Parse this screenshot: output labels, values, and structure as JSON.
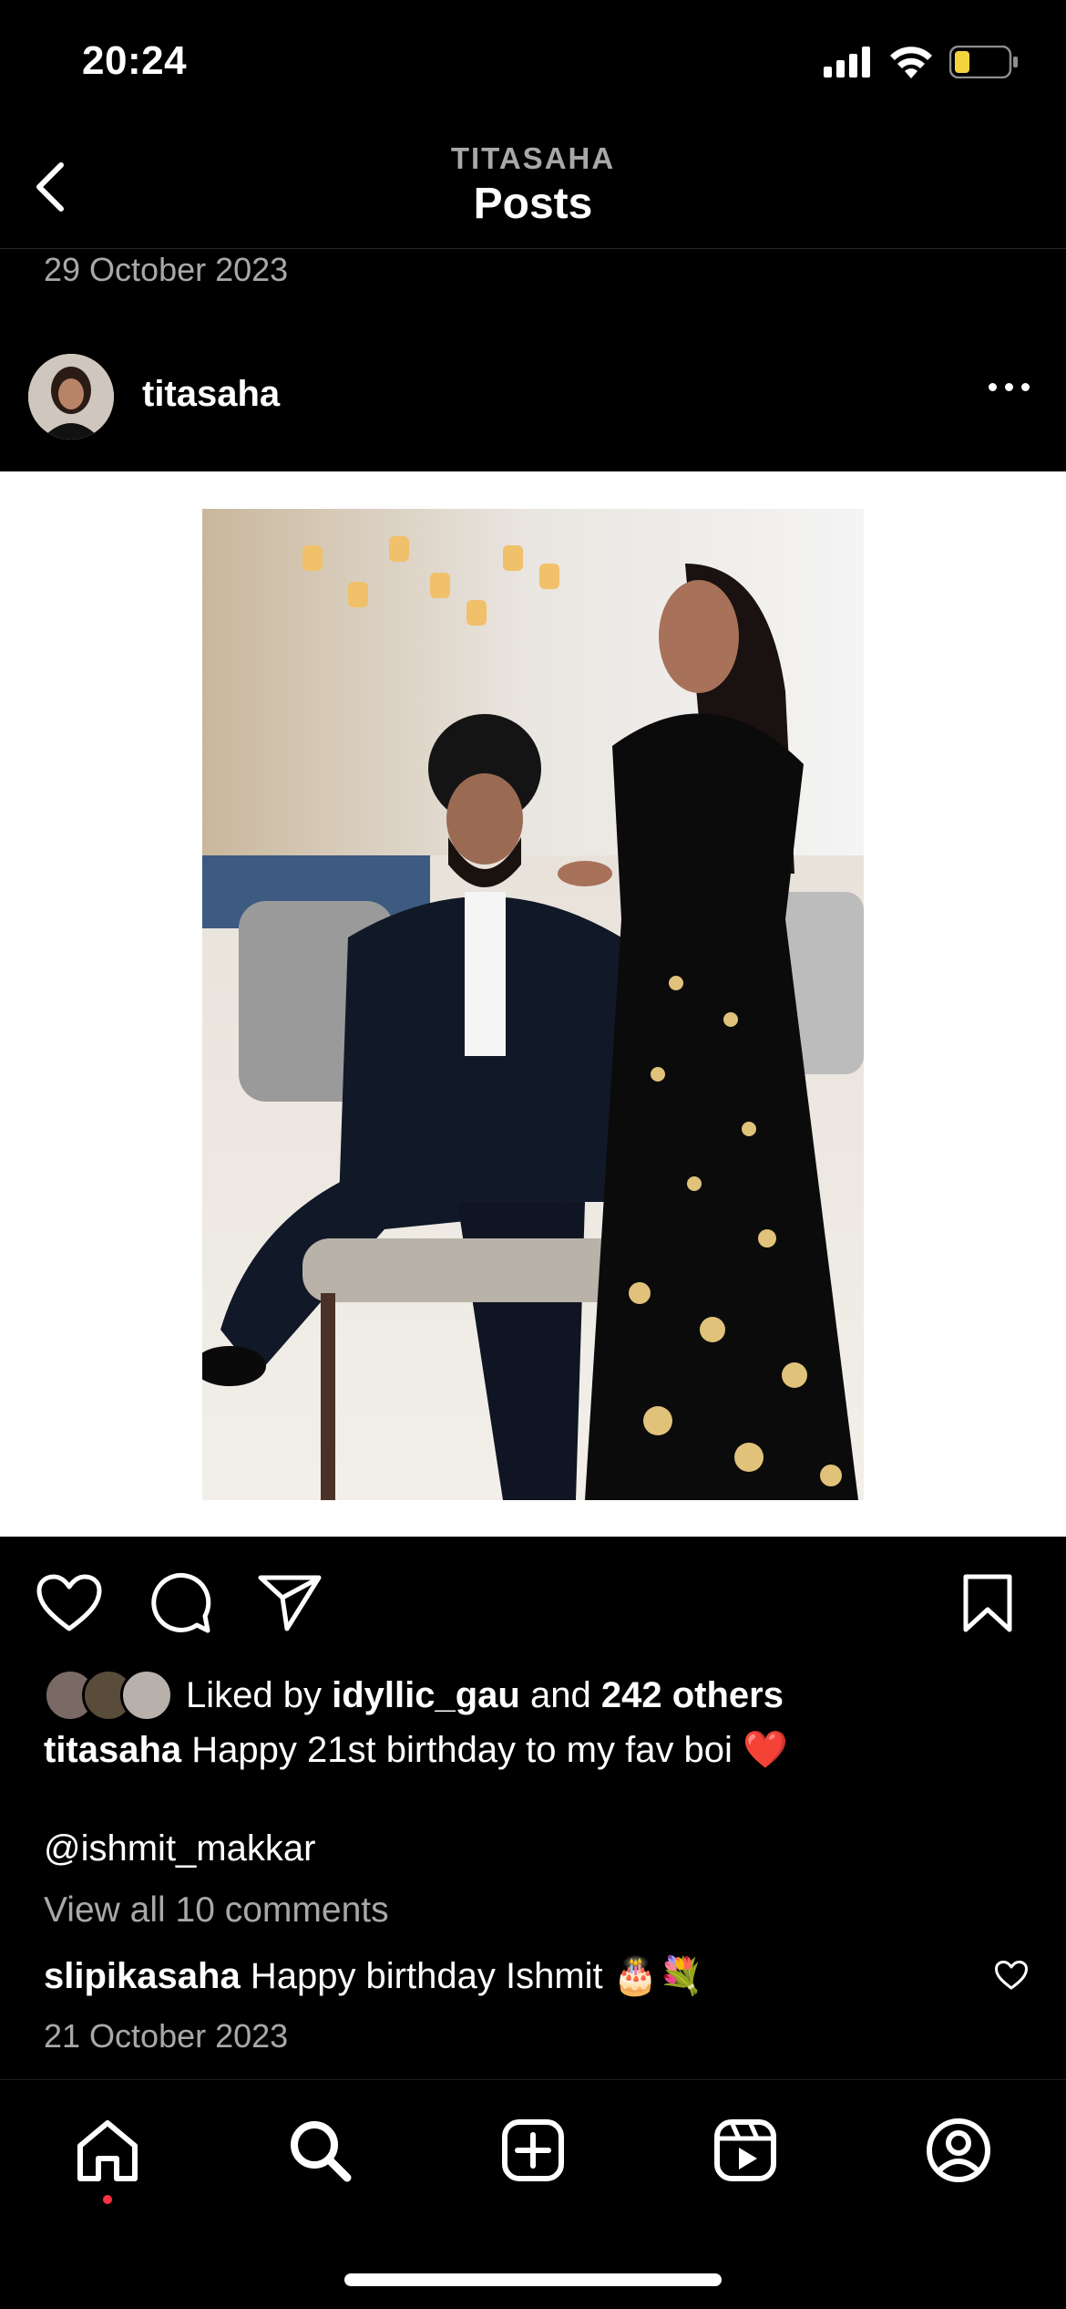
{
  "status_bar": {
    "time": "20:24",
    "icons": [
      "cellular-signal-icon",
      "wifi-icon",
      "battery-low-icon"
    ],
    "battery_color": "#f5d33c"
  },
  "header": {
    "account": "TITASAHA",
    "title": "Posts",
    "back_icon": "chevron-left-icon"
  },
  "previous_post_date": "29 October 2023",
  "post": {
    "username": "titasaha",
    "more_icon": "ellipsis-icon",
    "image_alt": "Couple portrait photo",
    "actions": {
      "like_icon": "heart-icon",
      "comment_icon": "comment-icon",
      "share_icon": "send-icon",
      "save_icon": "bookmark-icon"
    },
    "likes": {
      "prefix": "Liked by",
      "first_liker": "idyllic_gau",
      "connector": "and",
      "others": "242 others"
    },
    "caption": {
      "username": "titasaha",
      "text": "Happy 21st birthday to my fav boi ❤️",
      "mention": "@ishmit_makkar"
    },
    "view_comments": "View all 10 comments",
    "top_comment": {
      "username": "slipikasaha",
      "text": "Happy birthday Ishmit 🎂💐"
    },
    "date": "21 October 2023"
  },
  "tab_bar": {
    "items": [
      "home-icon",
      "search-icon",
      "create-icon",
      "reels-icon",
      "profile-icon"
    ],
    "notification_color": "#ff3040"
  }
}
